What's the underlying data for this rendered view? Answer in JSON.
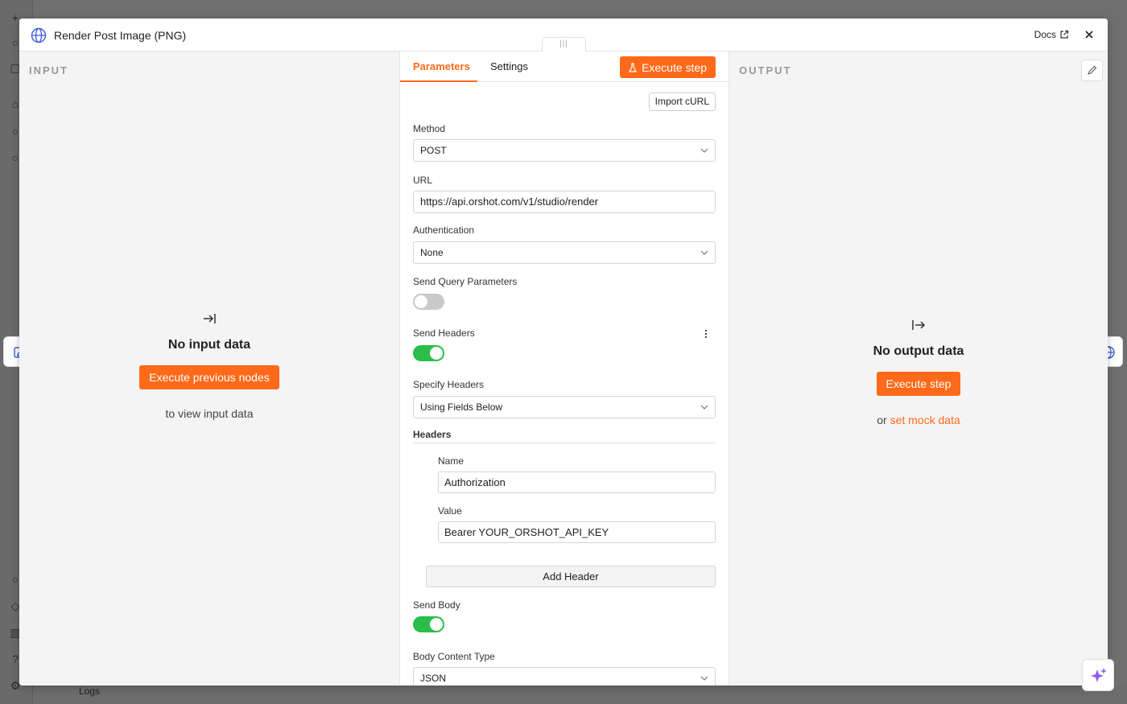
{
  "background": {
    "logs_label": "Logs"
  },
  "modal": {
    "title": "Render Post Image (PNG)",
    "docs_label": "Docs",
    "drag_handle": "|||"
  },
  "input_panel": {
    "label": "INPUT",
    "empty_title": "No input data",
    "button": "Execute previous nodes",
    "sub": "to view input data"
  },
  "output_panel": {
    "label": "OUTPUT",
    "empty_title": "No output data",
    "button": "Execute step",
    "sub_prefix": "or",
    "sub_link": "set mock data"
  },
  "tabs": [
    {
      "label": "Parameters",
      "active": true
    },
    {
      "label": "Settings",
      "active": false
    }
  ],
  "execute_step": "Execute step",
  "import_curl": "Import cURL",
  "params": {
    "method_label": "Method",
    "method_value": "POST",
    "url_label": "URL",
    "url_value": "https://api.orshot.com/v1/studio/render",
    "auth_label": "Authentication",
    "auth_value": "None",
    "query_label": "Send Query Parameters",
    "query_on": false,
    "headers_label": "Send Headers",
    "headers_on": true,
    "specify_label": "Specify Headers",
    "specify_value": "Using Fields Below",
    "headers_section": "Headers",
    "name_label": "Name",
    "name_value": "Authorization",
    "value_label": "Value",
    "value_value": "Bearer YOUR_ORSHOT_API_KEY",
    "add_header": "Add Header",
    "body_label": "Send Body",
    "body_on": true,
    "content_type_label": "Body Content Type",
    "content_type_value": "JSON"
  },
  "colors": {
    "accent": "#ff6a1a",
    "toggle_on": "#2bbd4a",
    "toggle_off": "#c9c9c9",
    "link_icon": "#3a5bd9",
    "ai_icon": "#8a5cf6"
  }
}
